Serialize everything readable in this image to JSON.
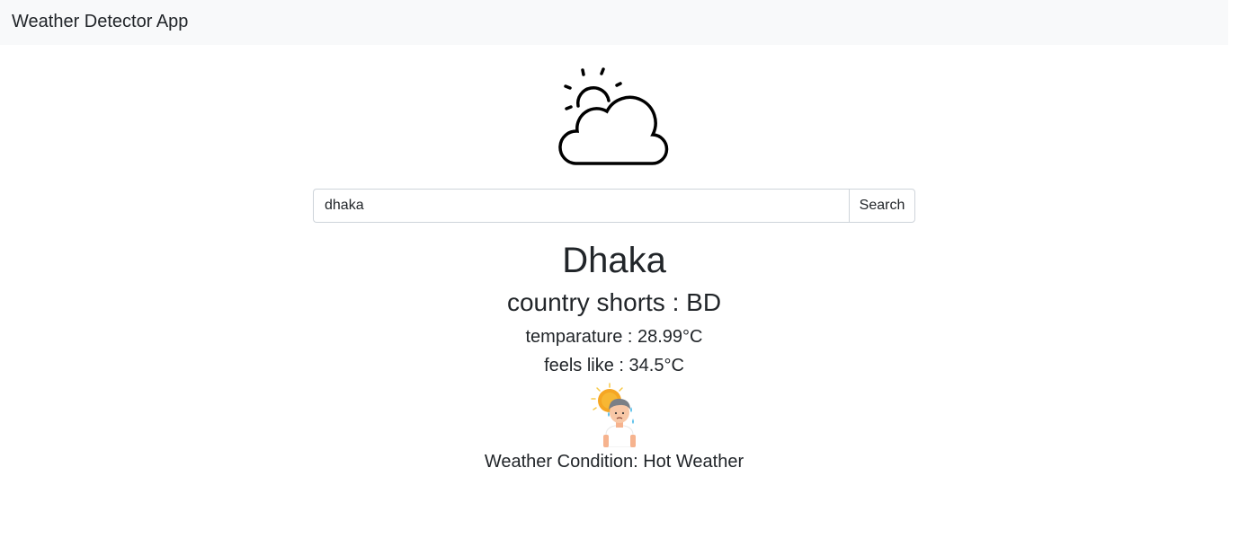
{
  "app": {
    "title": "Weather Detector App"
  },
  "search": {
    "value": "dhaka",
    "button_label": "Search"
  },
  "weather": {
    "city": "Dhaka",
    "country_line": "country shorts : BD",
    "temperature_line": "temparature : 28.99°C",
    "feels_like_line": "feels like : 34.5°C",
    "condition_line": "Weather Condition: Hot Weather"
  },
  "icons": {
    "hero": "partly-cloudy-icon",
    "condition": "hot-weather-person-icon"
  }
}
